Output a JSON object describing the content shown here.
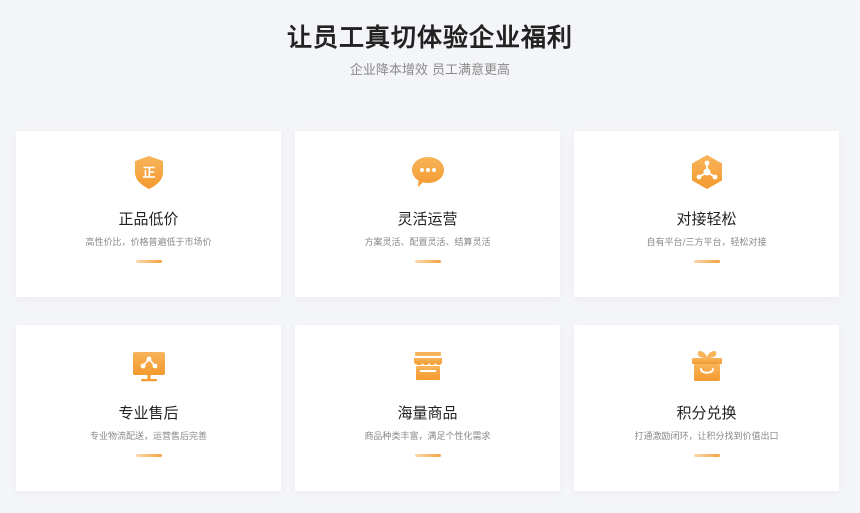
{
  "hero": {
    "title": "让员工真切体验企业福利",
    "subtitle": "企业降本增效 员工满意更高"
  },
  "colors": {
    "accent": "#f5a342",
    "accent_light": "#fcd9ad",
    "background": "#f4f5f8",
    "card": "#ffffff"
  },
  "features": [
    {
      "icon": "shield-authentic-icon",
      "icon_text": "正",
      "title": "正品低价",
      "desc": "高性价比，价格普遍低于市场价"
    },
    {
      "icon": "chat-bubble-icon",
      "title": "灵活运营",
      "desc": "方案灵活、配置灵活、结算灵活"
    },
    {
      "icon": "hexagon-network-icon",
      "title": "对接轻松",
      "desc": "自有平台/三方平台，轻松对接"
    },
    {
      "icon": "monitor-share-icon",
      "title": "专业售后",
      "desc": "专业物流配送，运营售后完善"
    },
    {
      "icon": "store-icon",
      "title": "海量商品",
      "desc": "商品种类丰富，满足个性化需求"
    },
    {
      "icon": "gift-box-icon",
      "title": "积分兑换",
      "desc": "打通激励闭环，让积分找到价值出口"
    }
  ]
}
